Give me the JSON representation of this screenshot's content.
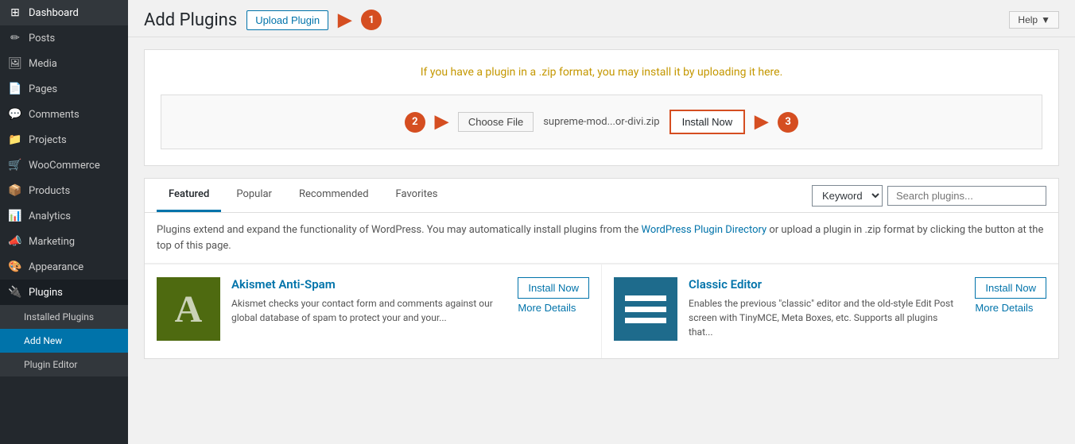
{
  "header": {
    "help_label": "Help",
    "page_title": "Add Plugins",
    "upload_plugin_label": "Upload Plugin"
  },
  "sidebar": {
    "items": [
      {
        "id": "dashboard",
        "label": "Dashboard",
        "icon": "⊞"
      },
      {
        "id": "posts",
        "label": "Posts",
        "icon": "✎"
      },
      {
        "id": "media",
        "label": "Media",
        "icon": "🖼"
      },
      {
        "id": "pages",
        "label": "Pages",
        "icon": "📄"
      },
      {
        "id": "comments",
        "label": "Comments",
        "icon": "💬"
      },
      {
        "id": "projects",
        "label": "Projects",
        "icon": "📁"
      },
      {
        "id": "woocommerce",
        "label": "WooCommerce",
        "icon": "🛒"
      },
      {
        "id": "products",
        "label": "Products",
        "icon": "📦"
      },
      {
        "id": "analytics",
        "label": "Analytics",
        "icon": "📊"
      },
      {
        "id": "marketing",
        "label": "Marketing",
        "icon": "📣"
      },
      {
        "id": "appearance",
        "label": "Appearance",
        "icon": "🎨"
      },
      {
        "id": "plugins",
        "label": "Plugins",
        "icon": "🔌"
      }
    ],
    "sub_items": [
      {
        "id": "installed-plugins",
        "label": "Installed Plugins"
      },
      {
        "id": "add-new",
        "label": "Add New"
      },
      {
        "id": "plugin-editor",
        "label": "Plugin Editor"
      }
    ]
  },
  "upload_section": {
    "instruction": "If you have a plugin in a .zip format, you may install it by uploading it here.",
    "choose_file_label": "Choose File",
    "filename": "supreme-mod...or-divi.zip",
    "install_now_label": "Install Now",
    "badge1": "1",
    "badge2": "2",
    "badge3": "3"
  },
  "tabs": {
    "items": [
      {
        "id": "featured",
        "label": "Featured",
        "active": true
      },
      {
        "id": "popular",
        "label": "Popular",
        "active": false
      },
      {
        "id": "recommended",
        "label": "Recommended",
        "active": false
      },
      {
        "id": "favorites",
        "label": "Favorites",
        "active": false
      }
    ],
    "search_type_label": "Keyword",
    "search_placeholder": "Search plugins..."
  },
  "description": {
    "text1": "Plugins extend and expand the functionality of WordPress. You may automatically install plugins from the ",
    "link_text": "WordPress Plugin Directory",
    "text2": " or upload a plugin in .zip format by clicking the button at the top of this page."
  },
  "plugins": [
    {
      "id": "akismet",
      "name": "Akismet Anti-Spam",
      "icon_letter": "A",
      "excerpt": "Akismet checks your contact form and comments against our global database of spam to protect your and your...",
      "install_label": "Install Now",
      "more_details_label": "More Details"
    },
    {
      "id": "classic-editor",
      "name": "Classic Editor",
      "excerpt": "Enables the previous \"classic\" editor and the old-style Edit Post screen with TinyMCE, Meta Boxes, etc. Supports all plugins that...",
      "install_label": "Install Now",
      "more_details_label": "More Details"
    }
  ]
}
